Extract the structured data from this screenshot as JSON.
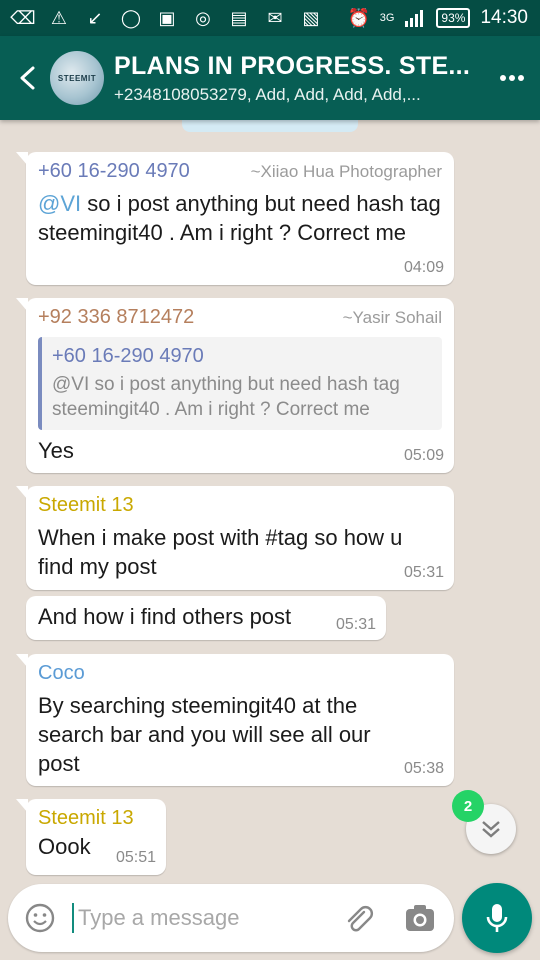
{
  "status_bar": {
    "battery": "93%",
    "time": "14:30",
    "network": "3G"
  },
  "header": {
    "title": "PLANS IN PROGRESS. STE...",
    "subtitle": "+2348108053279, Add, Add, Add, Add,...",
    "avatar_text": "STEEMIT"
  },
  "messages": [
    {
      "sender": "+60 16-290 4970",
      "sender_color": "#6a7bb8",
      "alias": "~Xiiao Hua Photographer",
      "mention": "@VI",
      "text": " so i post anything but need hash tag steemingit40 . Am i right ? Correct me",
      "time": "04:09"
    },
    {
      "sender": "+92 336 8712472",
      "sender_color": "#b57f5d",
      "alias": "~Yasir Sohail",
      "quote_sender": "+60 16-290 4970",
      "quote_text": "@VI so i post anything but need hash tag steemingit40 . Am i right ? Correct me",
      "text": "Yes",
      "time": "05:09"
    },
    {
      "sender": "Steemit 13",
      "sender_color": "#c9a800",
      "text": "When i make post with #tag so how u find my post",
      "time": "05:31"
    },
    {
      "text": "And how i find others post",
      "time": "05:31"
    },
    {
      "sender": "Coco",
      "sender_color": "#5b9bd5",
      "text": "By searching steemingit40 at the search bar and you will see all our post",
      "time": "05:38"
    },
    {
      "sender": "Steemit 13",
      "sender_color": "#c9a800",
      "text": "Oook",
      "time": "05:51"
    }
  ],
  "scroll": {
    "unread_count": "2"
  },
  "input": {
    "placeholder": "Type a message"
  },
  "colors": {
    "header": "#075e54",
    "status_bar": "#054d44",
    "mic_button": "#00897b",
    "badge": "#25d366"
  }
}
